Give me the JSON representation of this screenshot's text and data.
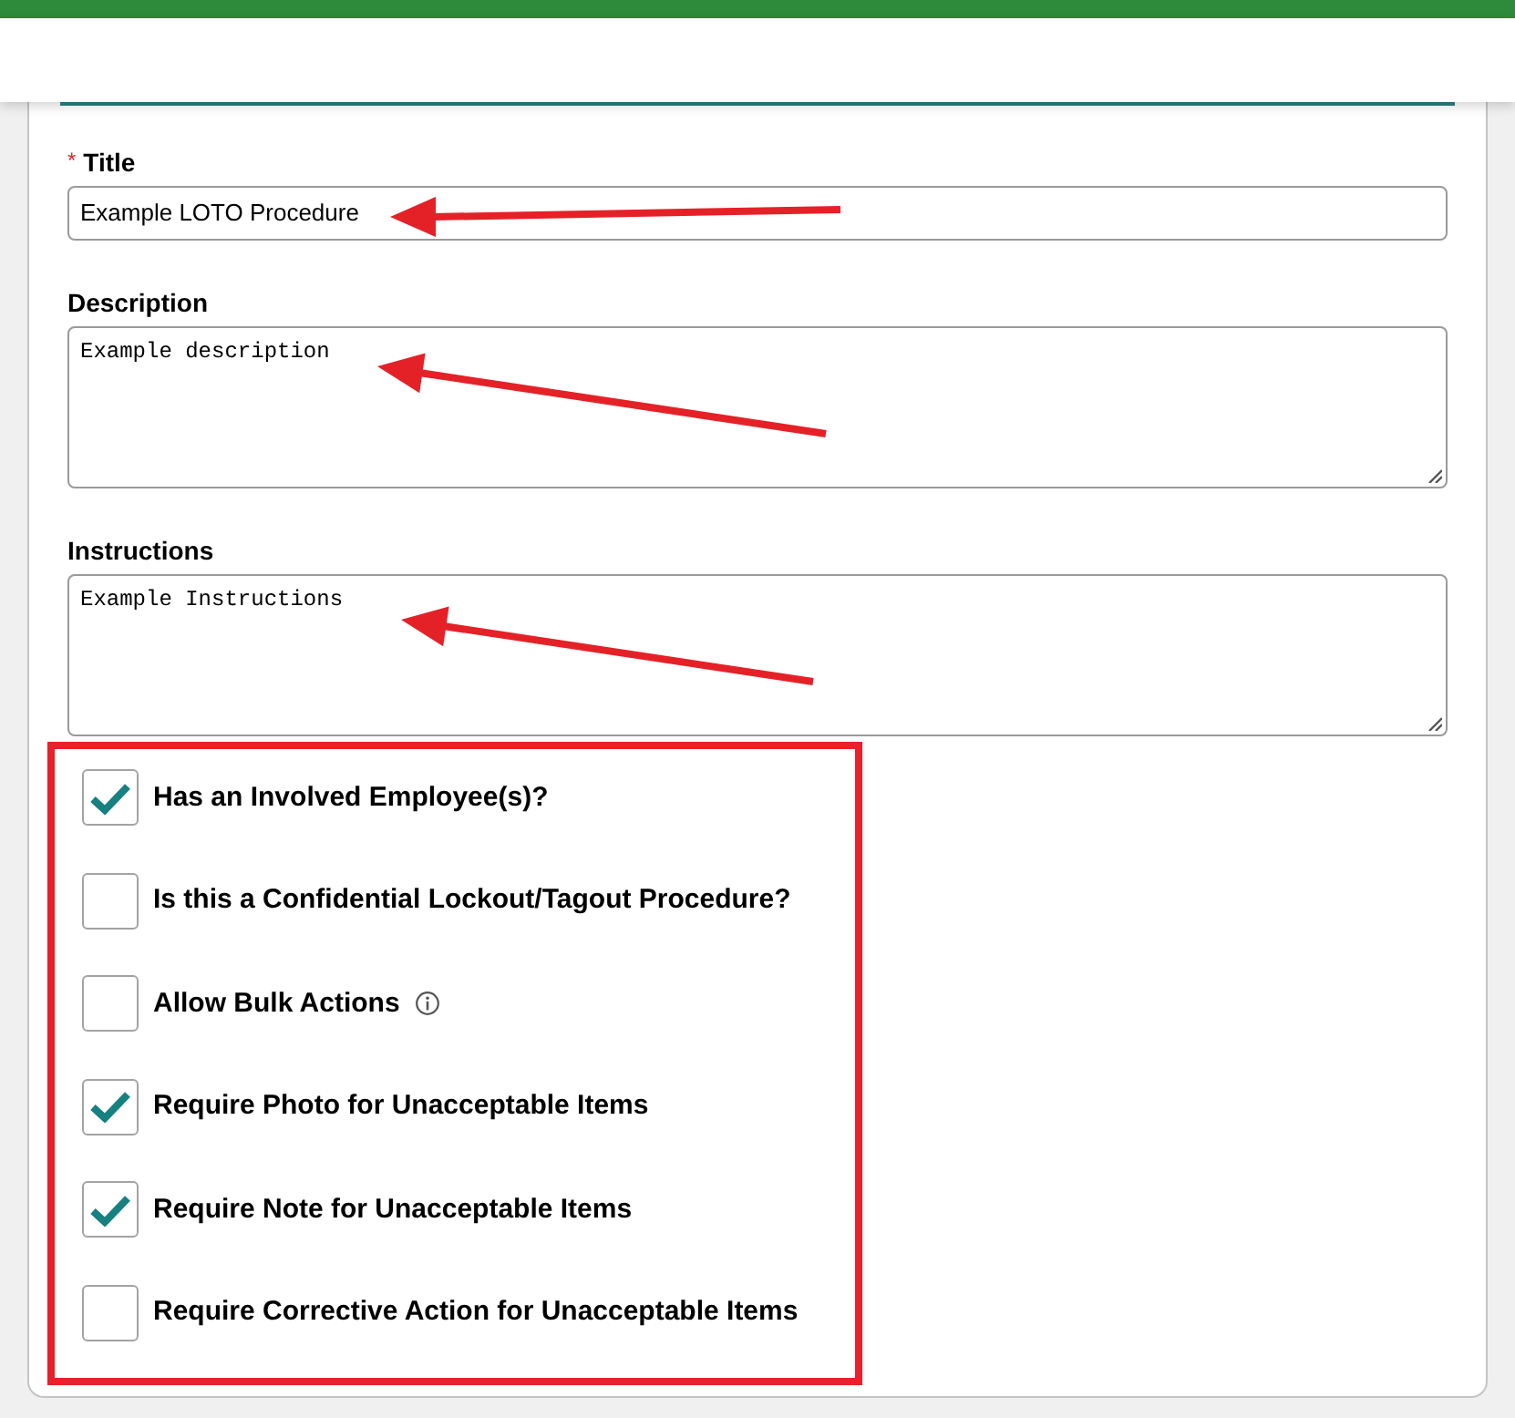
{
  "fields": [
    {
      "kind": "input",
      "required_mark": "*",
      "label": "Title",
      "value": "Example LOTO Procedure"
    },
    {
      "kind": "textarea",
      "label": "Description",
      "value": "Example description"
    },
    {
      "kind": "textarea",
      "label": "Instructions",
      "value": "Example Instructions"
    }
  ],
  "options": [
    {
      "label": "Has an Involved Employee(s)?",
      "checked": true,
      "info": false
    },
    {
      "label": "Is this a Confidential Lockout/Tagout Procedure?",
      "checked": false,
      "info": false
    },
    {
      "label": "Allow Bulk Actions",
      "checked": false,
      "info": true
    },
    {
      "label": "Require Photo for Unacceptable Items",
      "checked": true,
      "info": false
    },
    {
      "label": "Require Note for Unacceptable Items",
      "checked": true,
      "info": false
    },
    {
      "label": "Require Corrective Action for Unacceptable Items",
      "checked": false,
      "info": false
    }
  ]
}
